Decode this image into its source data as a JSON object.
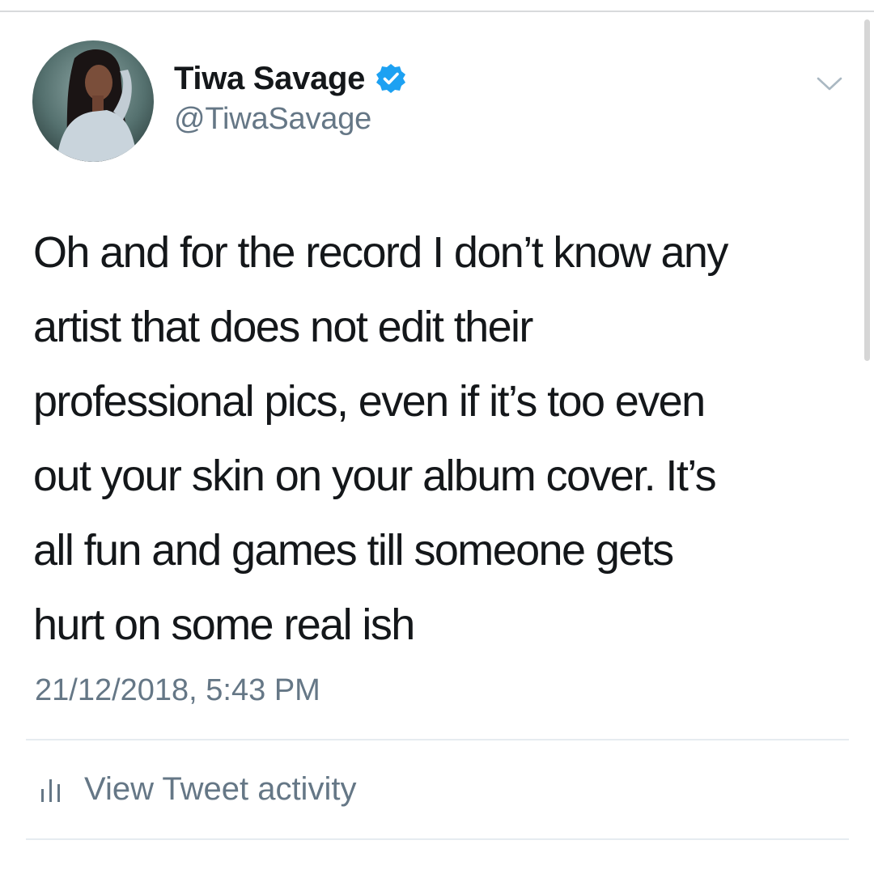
{
  "author": {
    "display_name": "Tiwa Savage",
    "handle": "@TiwaSavage",
    "verified": true,
    "avatar_icon": "profile-photo"
  },
  "tweet": {
    "text": "Oh and for the record I don’t know any\nartist that does not edit their\nprofessional pics, even if it’s too even\nout your skin on your album cover. It’s\nall fun and games till someone gets\nhurt on some real ish",
    "timestamp": "21/12/2018, 5:43 PM"
  },
  "actions": {
    "view_activity_label": "View Tweet activity",
    "view_activity_icon": "analytics-bars-icon",
    "menu_icon": "chevron-down-icon"
  },
  "colors": {
    "verified_badge": "#1da1f2",
    "primary_text": "#14171a",
    "secondary_text": "#657786",
    "divider": "#e6ecf0"
  }
}
